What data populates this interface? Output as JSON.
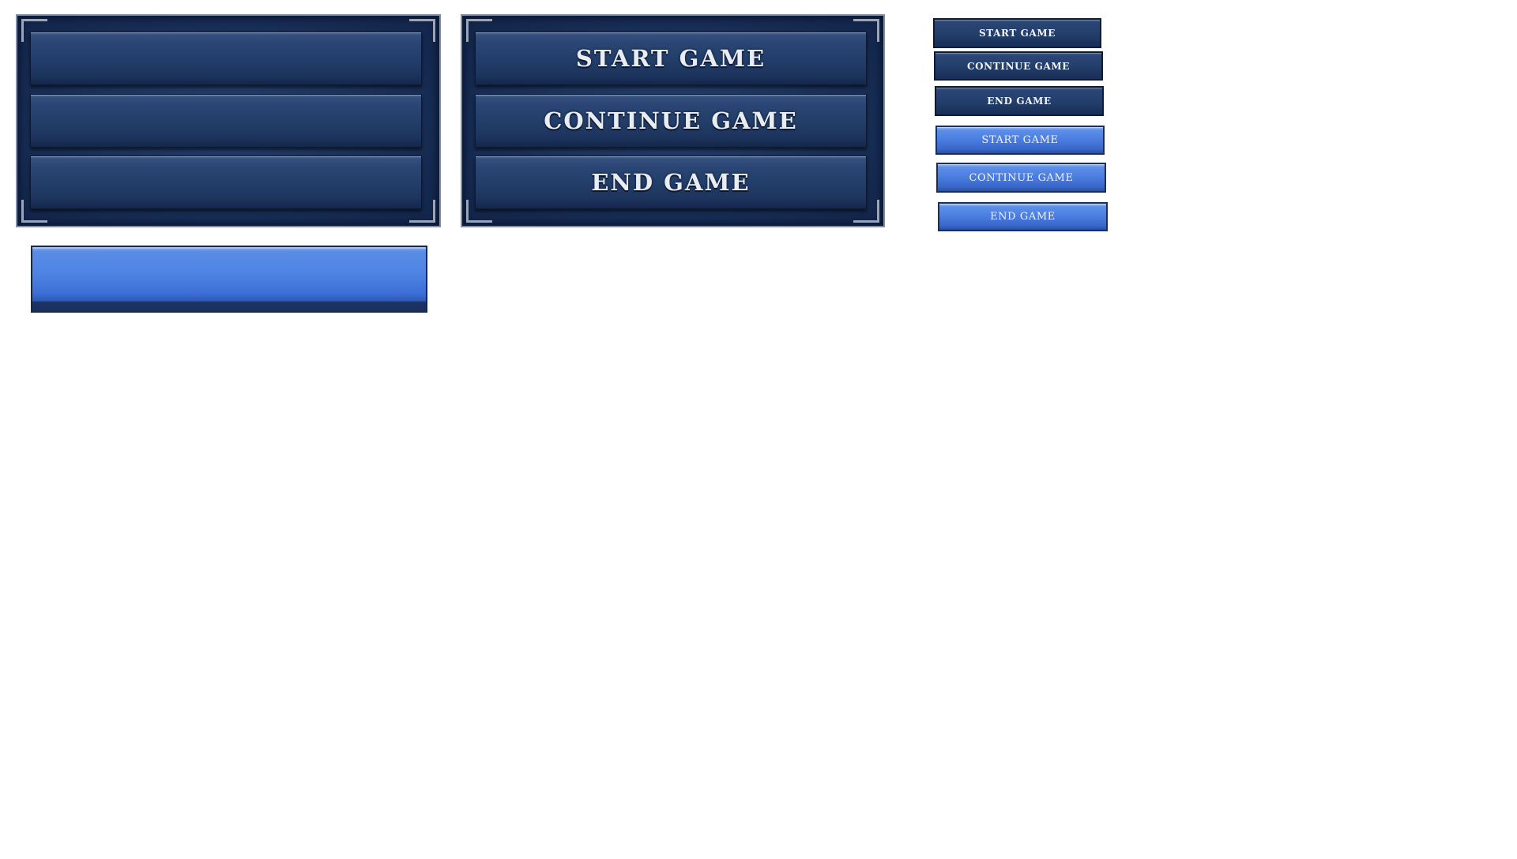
{
  "panel_labeled": {
    "buttons": [
      {
        "label": "START GAME"
      },
      {
        "label": "CONTINUE GAME"
      },
      {
        "label": "END GAME"
      }
    ]
  },
  "small_buttons": {
    "normal": [
      {
        "label": "START GAME"
      },
      {
        "label": "CONTINUE GAME"
      },
      {
        "label": "END GAME"
      }
    ],
    "highlighted": [
      {
        "label": "START GAME"
      },
      {
        "label": "CONTINUE GAME"
      },
      {
        "label": "END GAME"
      }
    ]
  },
  "colors": {
    "panel_dark_blue": "#1a3058",
    "button_dark_blue": "#233f6b",
    "button_highlight_blue": "#4a7ce0",
    "frame_silver": "#9aa6b8",
    "label_text": "#e9ecf1"
  }
}
